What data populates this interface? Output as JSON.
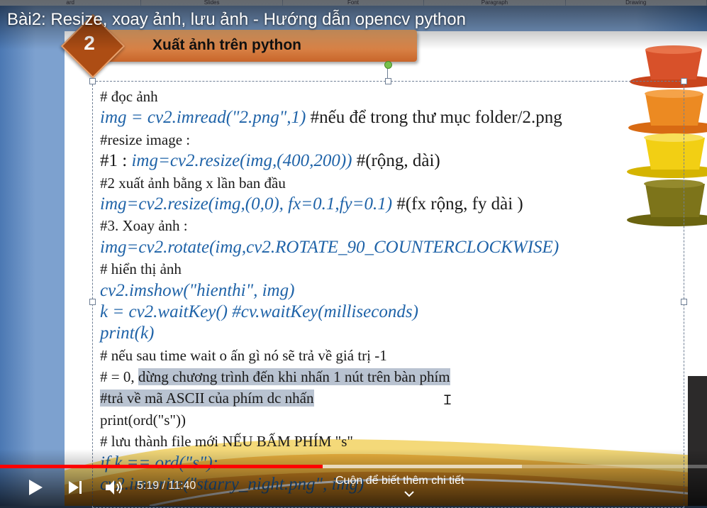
{
  "video": {
    "title": "Bài2: Resize, xoay ảnh, lưu ảnh - Hướng dẫn opencv python",
    "current_time": "5:19",
    "separator": "/",
    "duration": "11:40",
    "time_display": "5:19 / 11:40",
    "played_fraction": 0.456,
    "buffered_fraction": 0.738,
    "more_info": "Cuộn để biết thêm chi tiết"
  },
  "ribbon": {
    "items": [
      "ard",
      "Slides",
      "Font",
      "Paragraph",
      "Drawing"
    ]
  },
  "slide": {
    "number": "2",
    "heading": "Xuất ảnh trên python",
    "lines": [
      {
        "parts": [
          {
            "t": "# đọc ảnh",
            "s": "normal"
          }
        ]
      },
      {
        "parts": [
          {
            "t": "img = cv2.imread(\"2.png\",1) ",
            "s": "code"
          },
          {
            "t": "#nếu để trong thư mục folder/2.png",
            "s": "normal"
          }
        ]
      },
      {
        "parts": [
          {
            "t": "#resize image :",
            "s": "normal"
          }
        ]
      },
      {
        "parts": [
          {
            "t": "#1 : ",
            "s": "normal"
          },
          {
            "t": "img=cv2.resize(img,(400,200)) ",
            "s": "code"
          },
          {
            "t": " #(rộng, dài)",
            "s": "normal"
          }
        ]
      },
      {
        "parts": [
          {
            "t": "#2 xuất ảnh bằng x lần ban đầu",
            "s": "normal"
          }
        ]
      },
      {
        "parts": [
          {
            "t": "img=cv2.resize(img,(0,0), fx=0.1,fy=0.1) ",
            "s": "code"
          },
          {
            "t": "#(fx rộng, fy dài )",
            "s": "normal"
          }
        ]
      },
      {
        "parts": [
          {
            "t": "#3. Xoay ảnh :",
            "s": "normal"
          }
        ]
      },
      {
        "parts": [
          {
            "t": "img=cv2.rotate(img,cv2.ROTATE_90_COUNTERCLOCKWISE)",
            "s": "code"
          }
        ]
      },
      {
        "parts": [
          {
            "t": "# hiển thị ảnh",
            "s": "normal"
          }
        ]
      },
      {
        "parts": [
          {
            "t": "cv2.imshow(\"hienthi\", img)",
            "s": "code"
          }
        ]
      },
      {
        "parts": [
          {
            "t": "k = cv2.waitKey() #cv.waitKey(milliseconds)",
            "s": "code"
          }
        ]
      },
      {
        "parts": [
          {
            "t": "print(k)",
            "s": "code"
          }
        ]
      },
      {
        "parts": [
          {
            "t": "# nếu sau time wait o ấn gì nó sẽ trả về giá trị -1",
            "s": "normal"
          }
        ]
      },
      {
        "parts": [
          {
            "t": "# = 0, ",
            "s": "normal"
          },
          {
            "t": "dừng chương trình đến khi nhấn 1 nút trên bàn phím ",
            "s": "sel"
          }
        ]
      },
      {
        "parts": [
          {
            "t": "#trả về mã ASCII của phím dc nhấn      ",
            "s": "sel"
          }
        ]
      },
      {
        "parts": [
          {
            "t": "print(ord(\"s\"))",
            "s": "normal"
          }
        ]
      },
      {
        "parts": [
          {
            "t": "# lưu thành file mới NẾU BẤM PHÍM \"s\"",
            "s": "normal"
          }
        ]
      },
      {
        "parts": [
          {
            "t": "if k == ord(\"s\"):",
            "s": "code"
          }
        ]
      },
      {
        "parts": [
          {
            "t": "    cv2.imwrite(\"starry_night.png\", img)",
            "s": "code"
          }
        ]
      }
    ]
  },
  "colors": {
    "progress_played": "#ff0000",
    "code_text": "#1f63a8",
    "header_bar": "#d9783a"
  },
  "icons": [
    "play-icon",
    "next-icon",
    "volume-icon",
    "chevron-down-icon"
  ]
}
